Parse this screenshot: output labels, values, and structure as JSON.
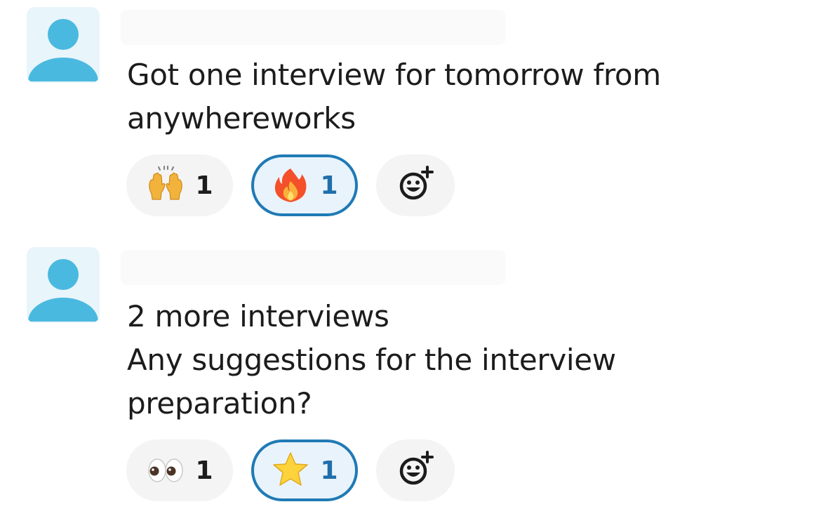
{
  "messages": [
    {
      "text": "Got one interview for tomorrow from\nanywhereworks",
      "reactions": [
        {
          "emoji": "raised-hands-icon",
          "count": "1",
          "selected": false
        },
        {
          "emoji": "fire-icon",
          "count": "1",
          "selected": true
        }
      ]
    },
    {
      "text": "2 more interviews\nAny suggestions for the interview\npreparation?",
      "reactions": [
        {
          "emoji": "eyes-icon",
          "count": "1",
          "selected": false
        },
        {
          "emoji": "star-icon",
          "count": "1",
          "selected": true
        }
      ]
    }
  ],
  "colors": {
    "avatar_bg": "#e8f5fa",
    "avatar_fg": "#4ab9e0",
    "reaction_bg": "#f4f4f4",
    "selected_border": "#1f7ab5",
    "selected_count": "#1f6fab",
    "text": "#1d1c1d"
  }
}
